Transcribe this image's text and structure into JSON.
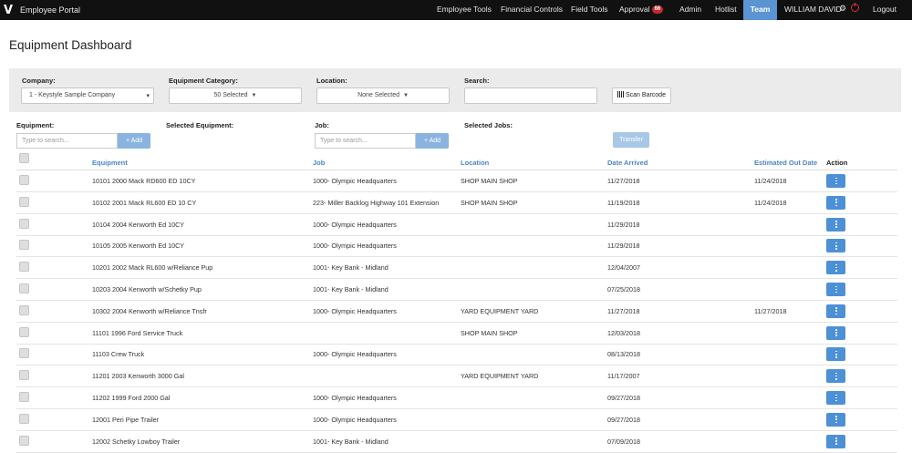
{
  "nav": {
    "brand_logo": "V",
    "brand_title": "Employee Portal",
    "items": [
      {
        "label": "Employee Tools"
      },
      {
        "label": "Financial Controls"
      },
      {
        "label": "Field Tools"
      },
      {
        "label": "Approval",
        "badge": "66"
      },
      {
        "label": "Admin"
      },
      {
        "label": "Hotlist"
      },
      {
        "label": "Team"
      }
    ],
    "user": "WILLIAM DAVID",
    "logout": "Logout",
    "active_color": "#5a94d2",
    "badge_color": "#c6282d"
  },
  "page_title": "Equipment Dashboard",
  "filters": {
    "company_label": "Company:",
    "company_value": "1 - Keystyle Sample Company",
    "category_label": "Equipment Category:",
    "category_value": "50 Selected",
    "location_label": "Location:",
    "location_value": "None Selected",
    "search_label": "Search:",
    "search_value": "",
    "scan_label": "Scan Barcode"
  },
  "equipment_picker": {
    "label": "Equipment:",
    "placeholder": "Type to search...",
    "add_label": "+ Add",
    "selected_label": "Selected Equipment:"
  },
  "job_picker": {
    "label": "Job:",
    "placeholder": "Type to search...",
    "add_label": "+ Add",
    "selected_label": "Selected Jobs:",
    "transfer_label": "Transfer"
  },
  "table": {
    "headers": {
      "equipment": "Equipment",
      "job": "Job",
      "location": "Location",
      "date_arrived": "Date Arrived",
      "estimated_out": "Estimated Out Date",
      "action": "Action"
    },
    "rows": [
      {
        "equipment": "10101 2000 Mack RD600 ED 10CY",
        "job": "1000- Olympic Headquarters",
        "location": "SHOP MAIN SHOP",
        "date_arrived": "11/27/2018",
        "estimated_out": "11/24/2018"
      },
      {
        "equipment": "10102 2001 Mack RL600 ED 10 CY",
        "job": "223- Miller Backlog Highway 101 Extension",
        "location": "SHOP MAIN SHOP",
        "date_arrived": "11/19/2018",
        "estimated_out": "11/24/2018"
      },
      {
        "equipment": "10104 2004 Kenworth Ed 10CY",
        "job": "1000- Olympic Headquarters",
        "location": "",
        "date_arrived": "11/29/2018",
        "estimated_out": ""
      },
      {
        "equipment": "10105 2005 Kenworth Ed 10CY",
        "job": "1000- Olympic Headquarters",
        "location": "",
        "date_arrived": "11/29/2018",
        "estimated_out": ""
      },
      {
        "equipment": "10201 2002 Mack RL600 w/Reliance Pup",
        "job": "1001- Key Bank - Midland",
        "location": "",
        "date_arrived": "12/04/2007",
        "estimated_out": ""
      },
      {
        "equipment": "10203 2004 Kenworth w/Schetky Pup",
        "job": "1001- Key Bank - Midland",
        "location": "",
        "date_arrived": "07/25/2018",
        "estimated_out": ""
      },
      {
        "equipment": "10302 2004 Kenworth w/Reliance Tnsfr",
        "job": "1000- Olympic Headquarters",
        "location": "YARD EQUIPMENT YARD",
        "date_arrived": "11/27/2018",
        "estimated_out": "11/27/2018"
      },
      {
        "equipment": "11101 1996 Ford Service Truck",
        "job": "",
        "location": "SHOP MAIN SHOP",
        "date_arrived": "12/03/2018",
        "estimated_out": ""
      },
      {
        "equipment": "11103 Crew Truck",
        "job": "1000- Olympic Headquarters",
        "location": "",
        "date_arrived": "08/13/2018",
        "estimated_out": ""
      },
      {
        "equipment": "11201 2003 Kenworth 3000 Gal",
        "job": "",
        "location": "YARD EQUIPMENT YARD",
        "date_arrived": "11/17/2007",
        "estimated_out": ""
      },
      {
        "equipment": "11202 1999 Ford 2000 Gal",
        "job": "1000- Olympic Headquarters",
        "location": "",
        "date_arrived": "09/27/2018",
        "estimated_out": ""
      },
      {
        "equipment": "12001 Peri Pipe Trailer",
        "job": "1000- Olympic Headquarters",
        "location": "",
        "date_arrived": "09/27/2018",
        "estimated_out": ""
      },
      {
        "equipment": "12002 Schetky Lowboy Trailer",
        "job": "1001- Key Bank - Midland",
        "location": "",
        "date_arrived": "07/09/2018",
        "estimated_out": ""
      }
    ]
  }
}
